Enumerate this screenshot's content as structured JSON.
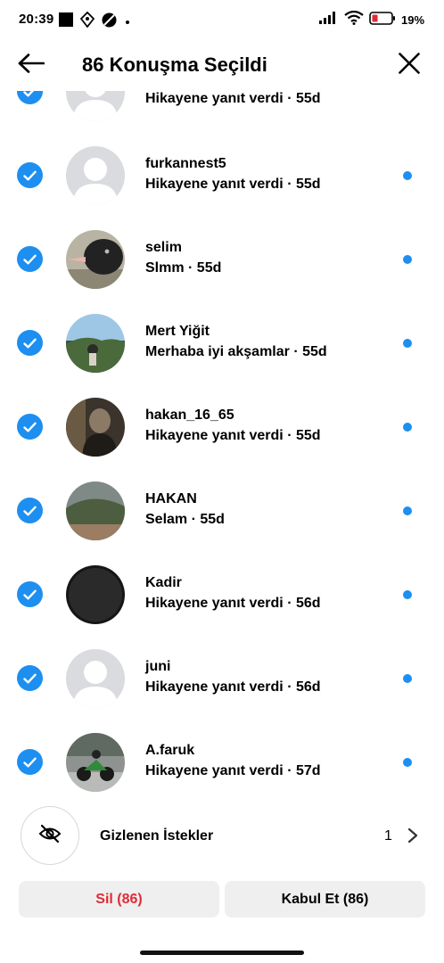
{
  "status_bar": {
    "time": "20:39",
    "battery_percent": "19",
    "left_icons": [
      "notification-square-icon",
      "location-tag-icon",
      "dnd-icon",
      "dot-icon"
    ],
    "right_icons": [
      "signal-icon",
      "wifi-icon",
      "battery-icon"
    ]
  },
  "header": {
    "title": "86 Konuşma Seçildi",
    "back_icon": "arrow-left-icon",
    "close_icon": "close-icon"
  },
  "colors": {
    "accent": "#1d8ff0",
    "danger": "#e02b36",
    "button_bg": "#efefef"
  },
  "conversations": [
    {
      "name": "",
      "preview": "Hikayene yanıt verdi · 55d",
      "avatar": "default-avatar",
      "selected": true,
      "unread": false,
      "partial": true
    },
    {
      "name": "furkannest5",
      "preview": "Hikayene yanıt verdi · 55d",
      "avatar": "default-avatar",
      "selected": true,
      "unread": true
    },
    {
      "name": "selim",
      "preview": "Slmm · 55d",
      "avatar": "bird-photo",
      "selected": true,
      "unread": true
    },
    {
      "name": "Mert Yiğit",
      "preview": "Merhaba iyi akşamlar · 55d",
      "avatar": "landscape-photo",
      "selected": true,
      "unread": true
    },
    {
      "name": "hakan_16_65",
      "preview": "Hikayene yanıt verdi · 55d",
      "avatar": "portrait-photo",
      "selected": true,
      "unread": true
    },
    {
      "name": "HAKAN",
      "preview": "Selam · 55d",
      "avatar": "hill-photo",
      "selected": true,
      "unread": true
    },
    {
      "name": "Kadir",
      "preview": "Hikayene yanıt verdi · 56d",
      "avatar": "dark-photo",
      "selected": true,
      "unread": true
    },
    {
      "name": "juni",
      "preview": "Hikayene yanıt verdi · 56d",
      "avatar": "default-avatar",
      "selected": true,
      "unread": true
    },
    {
      "name": "A.faruk",
      "preview": "Hikayene yanıt verdi · 57d",
      "avatar": "motorcycle-photo",
      "selected": true,
      "unread": true
    }
  ],
  "hidden_requests": {
    "label": "Gizlenen İstekler",
    "count": "1",
    "icon": "eye-off-icon"
  },
  "actions": {
    "delete_label": "Sil (86)",
    "accept_label": "Kabul Et (86)"
  }
}
